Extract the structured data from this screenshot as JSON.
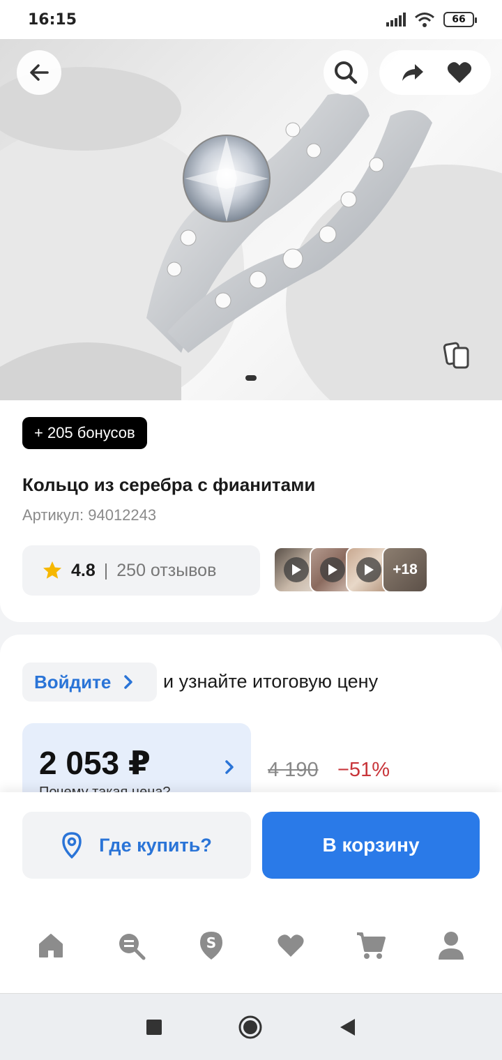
{
  "status_bar": {
    "time": "16:15",
    "battery": "66"
  },
  "product": {
    "bonus": "+ 205 бонусов",
    "title": "Кольцо из серебра с фианитами",
    "sku": "Артикул: 94012243",
    "rating": "4.8",
    "rating_sep": "|",
    "reviews": "250 отзывов",
    "media_more": "+18"
  },
  "price": {
    "login_label": "Войдите",
    "login_text": "и узнайте итоговую цену",
    "current": "2 053 ₽",
    "why": "Почему такая цена?",
    "old": "4 190",
    "discount": "−51%"
  },
  "actions": {
    "where_buy": "Где купить?",
    "add_to_cart": "В корзину"
  },
  "colors": {
    "accent": "#2a7ae8",
    "link": "#2a74d7",
    "discount": "#c8353a",
    "price_bg": "#e6eefb"
  },
  "nav": {
    "items": [
      "home-icon",
      "catalog-search-icon",
      "bonus-icon",
      "favorites-icon",
      "cart-icon",
      "profile-icon"
    ]
  },
  "gallery": {
    "slide_count": 1,
    "active_slide": 1
  }
}
